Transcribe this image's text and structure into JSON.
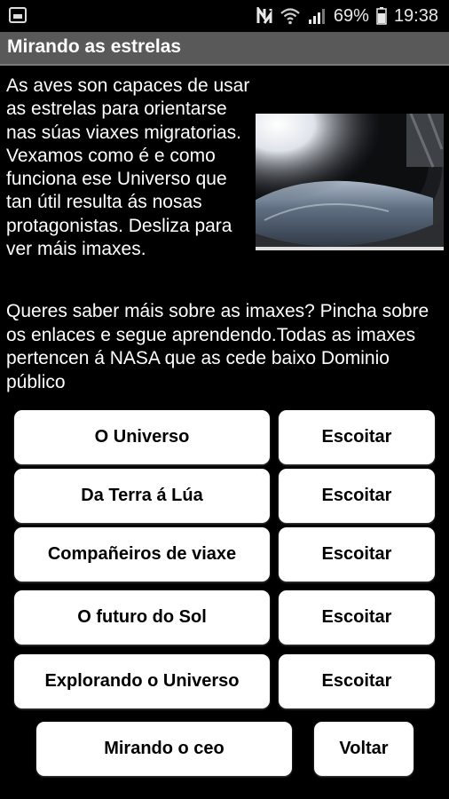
{
  "status_bar": {
    "battery_percent": "69%",
    "time": "19:38",
    "icons": [
      "screenshot-icon",
      "nfc-icon",
      "wifi-icon",
      "signal-icon",
      "battery-icon"
    ]
  },
  "title": "Mirando as estrelas",
  "intro_text": "As aves son capaces de usar as estrelas para orientarse nas súas viaxes migratorias. Vexamos como é e como funciona ese Universo que tan útil resulta ás nosas protagonistas. Desliza para ver máis imaxes.",
  "more_info_text": " Queres saber máis sobre as imaxes? Pincha sobre os enlaces e segue aprendendo.Todas as imaxes pertencen á NASA que as cede baixo Dominio público",
  "rows": [
    {
      "label": "O Universo",
      "listen": "Escoitar"
    },
    {
      "label": "Da Terra á Lúa",
      "listen": "Escoitar"
    },
    {
      "label": "Compañeiros de viaxe",
      "listen": "Escoitar"
    },
    {
      "label": "O futuro do Sol",
      "listen": "Escoitar"
    },
    {
      "label": "Explorando o Universo",
      "listen": "Escoitar"
    }
  ],
  "bottom": {
    "sky_label": "Mirando o ceo",
    "back_label": "Voltar"
  },
  "colors": {
    "background": "#000000",
    "title_bar": "#595959",
    "button": "#ffffff"
  }
}
